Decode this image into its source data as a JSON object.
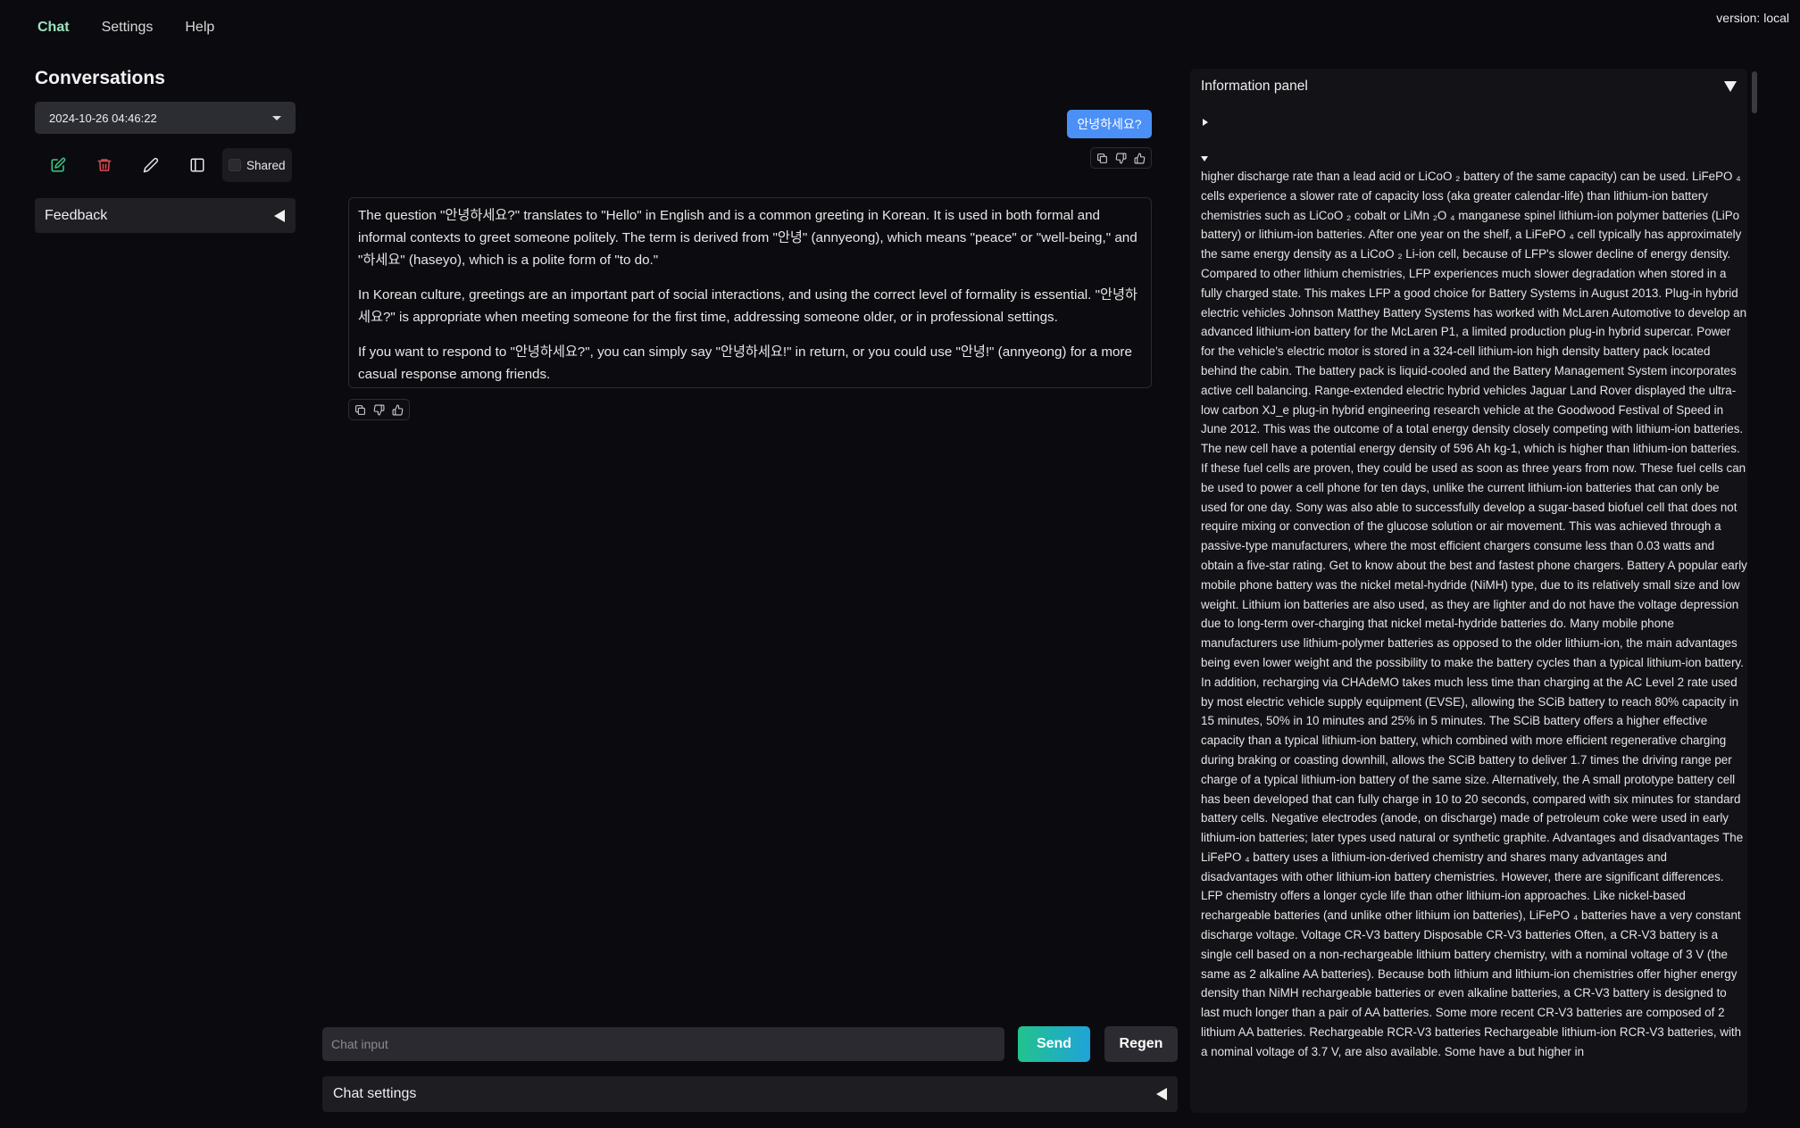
{
  "nav": {
    "items": [
      "Chat",
      "Settings",
      "Help"
    ],
    "active": "Chat"
  },
  "version": "version: local",
  "sidebar": {
    "title": "Conversations",
    "conversation_selected": "2024-10-26 04:46:22",
    "shared_label": "Shared",
    "feedback_label": "Feedback"
  },
  "chat": {
    "user_message": "안녕하세요?",
    "assistant_paragraphs": [
      "The question \"안녕하세요?\" translates to \"Hello\" in English and is a common greeting in Korean. It is used in both formal and informal contexts to greet someone politely. The term is derived from \"안녕\" (annyeong), which means \"peace\" or \"well-being,\" and \"하세요\" (haseyo), which is a polite form of \"to do.\"",
      "In Korean culture, greetings are an important part of social interactions, and using the correct level of formality is essential. \"안녕하세요?\" is appropriate when meeting someone for the first time, addressing someone older, or in professional settings.",
      "If you want to respond to \"안녕하세요?\", you can simply say \"안녕하세요!\" in return, or you could use \"안녕!\" (annyeong) for a more casual response among friends."
    ],
    "input_placeholder": "Chat input",
    "send_label": "Send",
    "regen_label": "Regen",
    "settings_label": "Chat settings"
  },
  "info_panel": {
    "title": "Information panel",
    "text": "higher discharge rate than a lead acid or LiCoO ₂ battery of the same capacity) can be used. LiFePO ₄ cells experience a slower rate of capacity loss (aka greater calendar-life) than lithium-ion battery chemistries such as LiCoO ₂ cobalt or LiMn ₂O ₄ manganese spinel lithium-ion polymer batteries (LiPo battery) or lithium-ion batteries. After one year on the shelf, a LiFePO ₄ cell typically has approximately the same energy density as a LiCoO ₂ Li-ion cell, because of LFP's slower decline of energy density. Compared to other lithium chemistries, LFP experiences much slower degradation when stored in a fully charged state. This makes LFP a good choice for Battery Systems in August 2013. Plug-in hybrid electric vehicles Johnson Matthey Battery Systems has worked with McLaren Automotive to develop an advanced lithium-ion battery for the McLaren P1, a limited production plug-in hybrid supercar. Power for the vehicle's electric motor is stored in a 324-cell lithium-ion high density battery pack located behind the cabin. The battery pack is liquid-cooled and the Battery Management System incorporates active cell balancing. Range-extended electric hybrid vehicles Jaguar Land Rover displayed the ultra-low carbon XJ_e plug-in hybrid engineering research vehicle at the Goodwood Festival of Speed in June 2012. This was the outcome of a total energy density closely competing with lithium-ion batteries. The new cell have a potential energy density of 596 Ah kg-1, which is higher than lithium-ion batteries. If these fuel cells are proven, they could be used as soon as three years from now. These fuel cells can be used to power a cell phone for ten days, unlike the current lithium-ion batteries that can only be used for one day. Sony was also able to successfully develop a sugar-based biofuel cell that does not require mixing or convection of the glucose solution or air movement. This was achieved through a passive-type manufacturers, where the most efficient chargers consume less than 0.03 watts and obtain a five-star rating. Get to know about the best and fastest phone chargers. Battery A popular early mobile phone battery was the nickel metal-hydride (NiMH) type, due to its relatively small size and low weight. Lithium ion batteries are also used, as they are lighter and do not have the voltage depression due to long-term over-charging that nickel metal-hydride batteries do. Many mobile phone manufacturers use lithium-polymer batteries as opposed to the older lithium-ion, the main advantages being even lower weight and the possibility to make the battery cycles than a typical lithium-ion battery. In addition, recharging via CHAdeMO takes much less time than charging at the AC Level 2 rate used by most electric vehicle supply equipment (EVSE), allowing the SCiB battery to reach 80% capacity in 15 minutes, 50% in 10 minutes and 25% in 5 minutes. The SCiB battery offers a higher effective capacity than a typical lithium-ion battery, which combined with more efficient regenerative charging during braking or coasting downhill, allows the SCiB battery to deliver 1.7 times the driving range per charge of a typical lithium-ion battery of the same size. Alternatively, the A small prototype battery cell has been developed that can fully charge in 10 to 20 seconds, compared with six minutes for standard battery cells. Negative electrodes (anode, on discharge) made of petroleum coke were used in early lithium-ion batteries; later types used natural or synthetic graphite. Advantages and disadvantages The LiFePO ₄ battery uses a lithium-ion-derived chemistry and shares many advantages and disadvantages with other lithium-ion battery chemistries. However, there are significant differences. LFP chemistry offers a longer cycle life than other lithium-ion approaches. Like nickel-based rechargeable batteries (and unlike other lithium ion batteries), LiFePO ₄ batteries have a very constant discharge voltage. Voltage CR-V3 battery Disposable CR-V3 batteries Often, a CR-V3 battery is a single cell based on a non-rechargeable lithium battery chemistry, with a nominal voltage of 3 V (the same as 2 alkaline AA batteries). Because both lithium and lithium-ion chemistries offer higher energy density than NiMH rechargeable batteries or even alkaline batteries, a CR-V3 battery is designed to last much longer than a pair of AA batteries. Some more recent CR-V3 batteries are composed of 2 lithium AA batteries. Rechargeable RCR-V3 batteries Rechargeable lithium-ion RCR-V3 batteries, with a nominal voltage of 3.7 V, are also available. Some have a but higher in"
  },
  "colors": {
    "accent_green": "#9be3c0",
    "user_bubble": "#4b90f7",
    "delete_red": "#e5484d",
    "new_green": "#3cc98a"
  }
}
